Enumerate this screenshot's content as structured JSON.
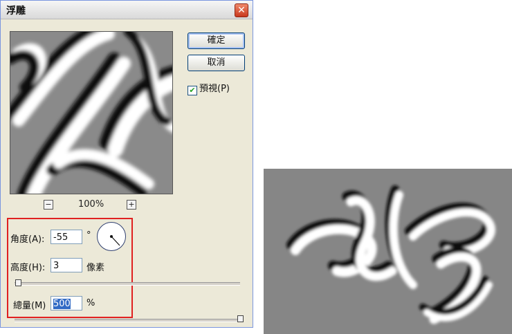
{
  "dialog": {
    "title": "浮雕",
    "ok_label": "確定",
    "cancel_label": "取消",
    "preview_label": "預視(P)",
    "preview_checked": true,
    "zoom": {
      "minus": "−",
      "plus": "+",
      "value": "100%"
    },
    "angle": {
      "label": "角度(A):",
      "value": "-55",
      "unit": "°"
    },
    "height": {
      "label": "高度(H):",
      "value": "3",
      "unit": "像素"
    },
    "amount": {
      "label": "總量(M)",
      "value": "500",
      "unit": "%"
    }
  }
}
